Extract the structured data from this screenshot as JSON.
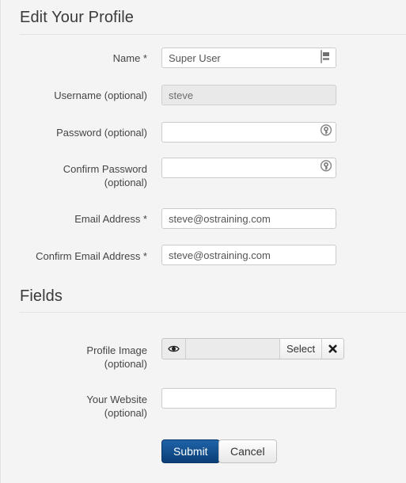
{
  "sections": {
    "profile": {
      "title": "Edit Your Profile"
    },
    "fields": {
      "title": "Fields"
    }
  },
  "form": {
    "name": {
      "label": "Name *",
      "value": "Super User",
      "placeholder": "",
      "icon": "autofill-card-icon"
    },
    "username": {
      "label": "Username (optional)",
      "value": "steve",
      "placeholder": "",
      "state": "disabled"
    },
    "password": {
      "label": "Password (optional)",
      "value": "",
      "placeholder": "",
      "icon": "key-icon"
    },
    "confirm_password": {
      "label_line1": "Confirm Password",
      "label_line2": "(optional)",
      "value": "",
      "placeholder": "",
      "icon": "key-icon"
    },
    "email": {
      "label": "Email Address *",
      "value": "steve@ostraining.com",
      "placeholder": ""
    },
    "confirm_email": {
      "label": "Confirm Email Address *",
      "value": "steve@ostraining.com",
      "placeholder": ""
    },
    "profile_image": {
      "label_line1": "Profile Image",
      "label_line2": "(optional)",
      "value": "",
      "placeholder": "",
      "preview_icon": "eye-icon",
      "select_label": "Select",
      "clear_icon": "close-x-icon"
    },
    "website": {
      "label_line1": "Your Website",
      "label_line2": "(optional)",
      "value": "",
      "placeholder": ""
    }
  },
  "actions": {
    "submit_label": "Submit",
    "cancel_label": "Cancel"
  },
  "colors": {
    "page_background": "#f4f4f4",
    "primary_button_top": "#1f63a8",
    "primary_button_bottom": "#0b3f77",
    "text": "#454545",
    "divider": "#e4e4e4",
    "input_border": "#cbcbcb",
    "disabled_input_background": "#e9e9e9"
  }
}
